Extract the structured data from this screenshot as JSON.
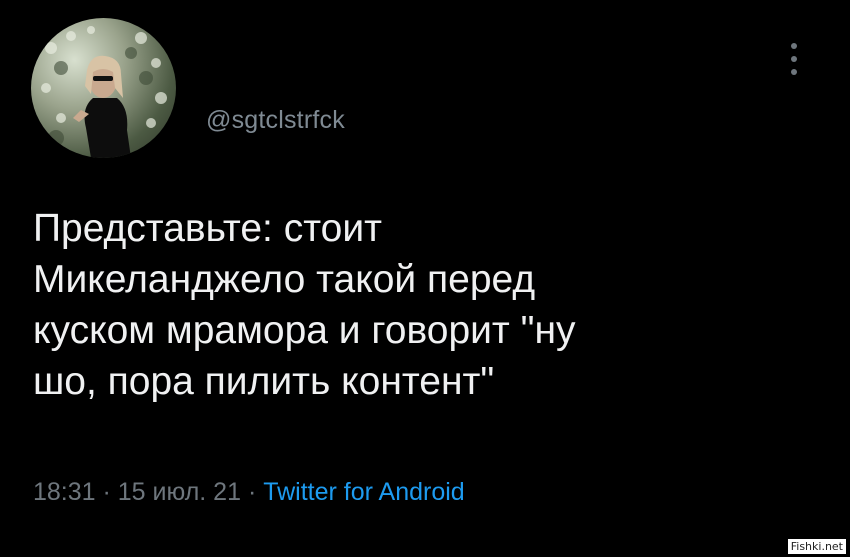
{
  "tweet": {
    "handle": "@sgtclstrfck",
    "text": "Представьте: стоит\nМикеланджело такой перед\nкуском мрамора и говорит \"ну\nшо, пора пилить контент\"",
    "time": "18:31",
    "sep1": " · ",
    "date": "15 июл. 21",
    "sep2": " · ",
    "source": "Twitter for Android"
  },
  "icons": {
    "more": "more-vertical-icon",
    "avatar": "profile-photo"
  },
  "colors": {
    "background": "#000000",
    "text": "#f0f1f2",
    "muted": "#6e767d",
    "link": "#1d9bf0"
  },
  "watermark": "Fishki.net"
}
